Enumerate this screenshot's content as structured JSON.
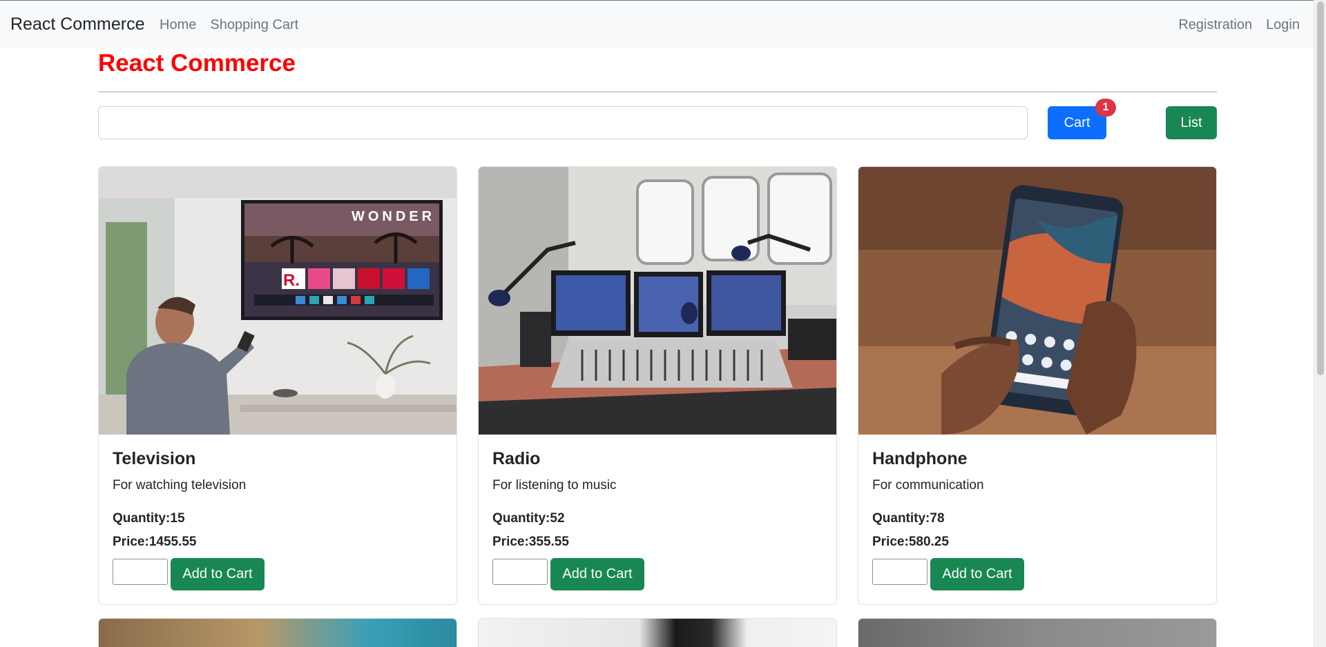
{
  "navbar": {
    "brand": "React Commerce",
    "left_links": [
      "Home",
      "Shopping Cart"
    ],
    "right_links": [
      "Registration",
      "Login"
    ]
  },
  "page": {
    "heading": "React Commerce",
    "heading_color": "#ff0000",
    "search_value": "",
    "cart_button": "Cart",
    "cart_badge": "1",
    "list_button": "List"
  },
  "products": [
    {
      "title": "Television",
      "description": "For watching television",
      "quantity_label": "Quantity:",
      "quantity": "15",
      "price_label": "Price:",
      "price": "1455.55",
      "qty_input_value": "",
      "add_button": "Add to Cart",
      "image_icon": "television-photo"
    },
    {
      "title": "Radio",
      "description": "For listening to music",
      "quantity_label": "Quantity:",
      "quantity": "52",
      "price_label": "Price:",
      "price": "355.55",
      "qty_input_value": "",
      "add_button": "Add to Cart",
      "image_icon": "radio-studio-photo"
    },
    {
      "title": "Handphone",
      "description": "For communication",
      "quantity_label": "Quantity:",
      "quantity": "78",
      "price_label": "Price:",
      "price": "580.25",
      "qty_input_value": "",
      "add_button": "Add to Cart",
      "image_icon": "handphone-photo"
    }
  ],
  "tv_screen_text": "WONDER",
  "tv_screen_logo": "R.",
  "colors": {
    "primary": "#0d6efd",
    "success": "#198754",
    "danger": "#dc3545"
  }
}
